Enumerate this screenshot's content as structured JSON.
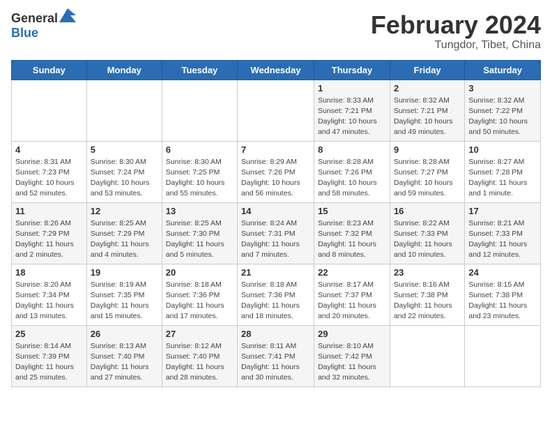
{
  "header": {
    "logo_general": "General",
    "logo_blue": "Blue",
    "month": "February 2024",
    "location": "Tungdor, Tibet, China"
  },
  "days_of_week": [
    "Sunday",
    "Monday",
    "Tuesday",
    "Wednesday",
    "Thursday",
    "Friday",
    "Saturday"
  ],
  "weeks": [
    [
      {
        "day": "",
        "detail": ""
      },
      {
        "day": "",
        "detail": ""
      },
      {
        "day": "",
        "detail": ""
      },
      {
        "day": "",
        "detail": ""
      },
      {
        "day": "1",
        "detail": "Sunrise: 8:33 AM\nSunset: 7:21 PM\nDaylight: 10 hours and 47 minutes."
      },
      {
        "day": "2",
        "detail": "Sunrise: 8:32 AM\nSunset: 7:21 PM\nDaylight: 10 hours and 49 minutes."
      },
      {
        "day": "3",
        "detail": "Sunrise: 8:32 AM\nSunset: 7:22 PM\nDaylight: 10 hours and 50 minutes."
      }
    ],
    [
      {
        "day": "4",
        "detail": "Sunrise: 8:31 AM\nSunset: 7:23 PM\nDaylight: 10 hours and 52 minutes."
      },
      {
        "day": "5",
        "detail": "Sunrise: 8:30 AM\nSunset: 7:24 PM\nDaylight: 10 hours and 53 minutes."
      },
      {
        "day": "6",
        "detail": "Sunrise: 8:30 AM\nSunset: 7:25 PM\nDaylight: 10 hours and 55 minutes."
      },
      {
        "day": "7",
        "detail": "Sunrise: 8:29 AM\nSunset: 7:26 PM\nDaylight: 10 hours and 56 minutes."
      },
      {
        "day": "8",
        "detail": "Sunrise: 8:28 AM\nSunset: 7:26 PM\nDaylight: 10 hours and 58 minutes."
      },
      {
        "day": "9",
        "detail": "Sunrise: 8:28 AM\nSunset: 7:27 PM\nDaylight: 10 hours and 59 minutes."
      },
      {
        "day": "10",
        "detail": "Sunrise: 8:27 AM\nSunset: 7:28 PM\nDaylight: 11 hours and 1 minute."
      }
    ],
    [
      {
        "day": "11",
        "detail": "Sunrise: 8:26 AM\nSunset: 7:29 PM\nDaylight: 11 hours and 2 minutes."
      },
      {
        "day": "12",
        "detail": "Sunrise: 8:25 AM\nSunset: 7:29 PM\nDaylight: 11 hours and 4 minutes."
      },
      {
        "day": "13",
        "detail": "Sunrise: 8:25 AM\nSunset: 7:30 PM\nDaylight: 11 hours and 5 minutes."
      },
      {
        "day": "14",
        "detail": "Sunrise: 8:24 AM\nSunset: 7:31 PM\nDaylight: 11 hours and 7 minutes."
      },
      {
        "day": "15",
        "detail": "Sunrise: 8:23 AM\nSunset: 7:32 PM\nDaylight: 11 hours and 8 minutes."
      },
      {
        "day": "16",
        "detail": "Sunrise: 8:22 AM\nSunset: 7:33 PM\nDaylight: 11 hours and 10 minutes."
      },
      {
        "day": "17",
        "detail": "Sunrise: 8:21 AM\nSunset: 7:33 PM\nDaylight: 11 hours and 12 minutes."
      }
    ],
    [
      {
        "day": "18",
        "detail": "Sunrise: 8:20 AM\nSunset: 7:34 PM\nDaylight: 11 hours and 13 minutes."
      },
      {
        "day": "19",
        "detail": "Sunrise: 8:19 AM\nSunset: 7:35 PM\nDaylight: 11 hours and 15 minutes."
      },
      {
        "day": "20",
        "detail": "Sunrise: 8:18 AM\nSunset: 7:36 PM\nDaylight: 11 hours and 17 minutes."
      },
      {
        "day": "21",
        "detail": "Sunrise: 8:18 AM\nSunset: 7:36 PM\nDaylight: 11 hours and 18 minutes."
      },
      {
        "day": "22",
        "detail": "Sunrise: 8:17 AM\nSunset: 7:37 PM\nDaylight: 11 hours and 20 minutes."
      },
      {
        "day": "23",
        "detail": "Sunrise: 8:16 AM\nSunset: 7:38 PM\nDaylight: 11 hours and 22 minutes."
      },
      {
        "day": "24",
        "detail": "Sunrise: 8:15 AM\nSunset: 7:38 PM\nDaylight: 11 hours and 23 minutes."
      }
    ],
    [
      {
        "day": "25",
        "detail": "Sunrise: 8:14 AM\nSunset: 7:39 PM\nDaylight: 11 hours and 25 minutes."
      },
      {
        "day": "26",
        "detail": "Sunrise: 8:13 AM\nSunset: 7:40 PM\nDaylight: 11 hours and 27 minutes."
      },
      {
        "day": "27",
        "detail": "Sunrise: 8:12 AM\nSunset: 7:40 PM\nDaylight: 11 hours and 28 minutes."
      },
      {
        "day": "28",
        "detail": "Sunrise: 8:11 AM\nSunset: 7:41 PM\nDaylight: 11 hours and 30 minutes."
      },
      {
        "day": "29",
        "detail": "Sunrise: 8:10 AM\nSunset: 7:42 PM\nDaylight: 11 hours and 32 minutes."
      },
      {
        "day": "",
        "detail": ""
      },
      {
        "day": "",
        "detail": ""
      }
    ]
  ]
}
